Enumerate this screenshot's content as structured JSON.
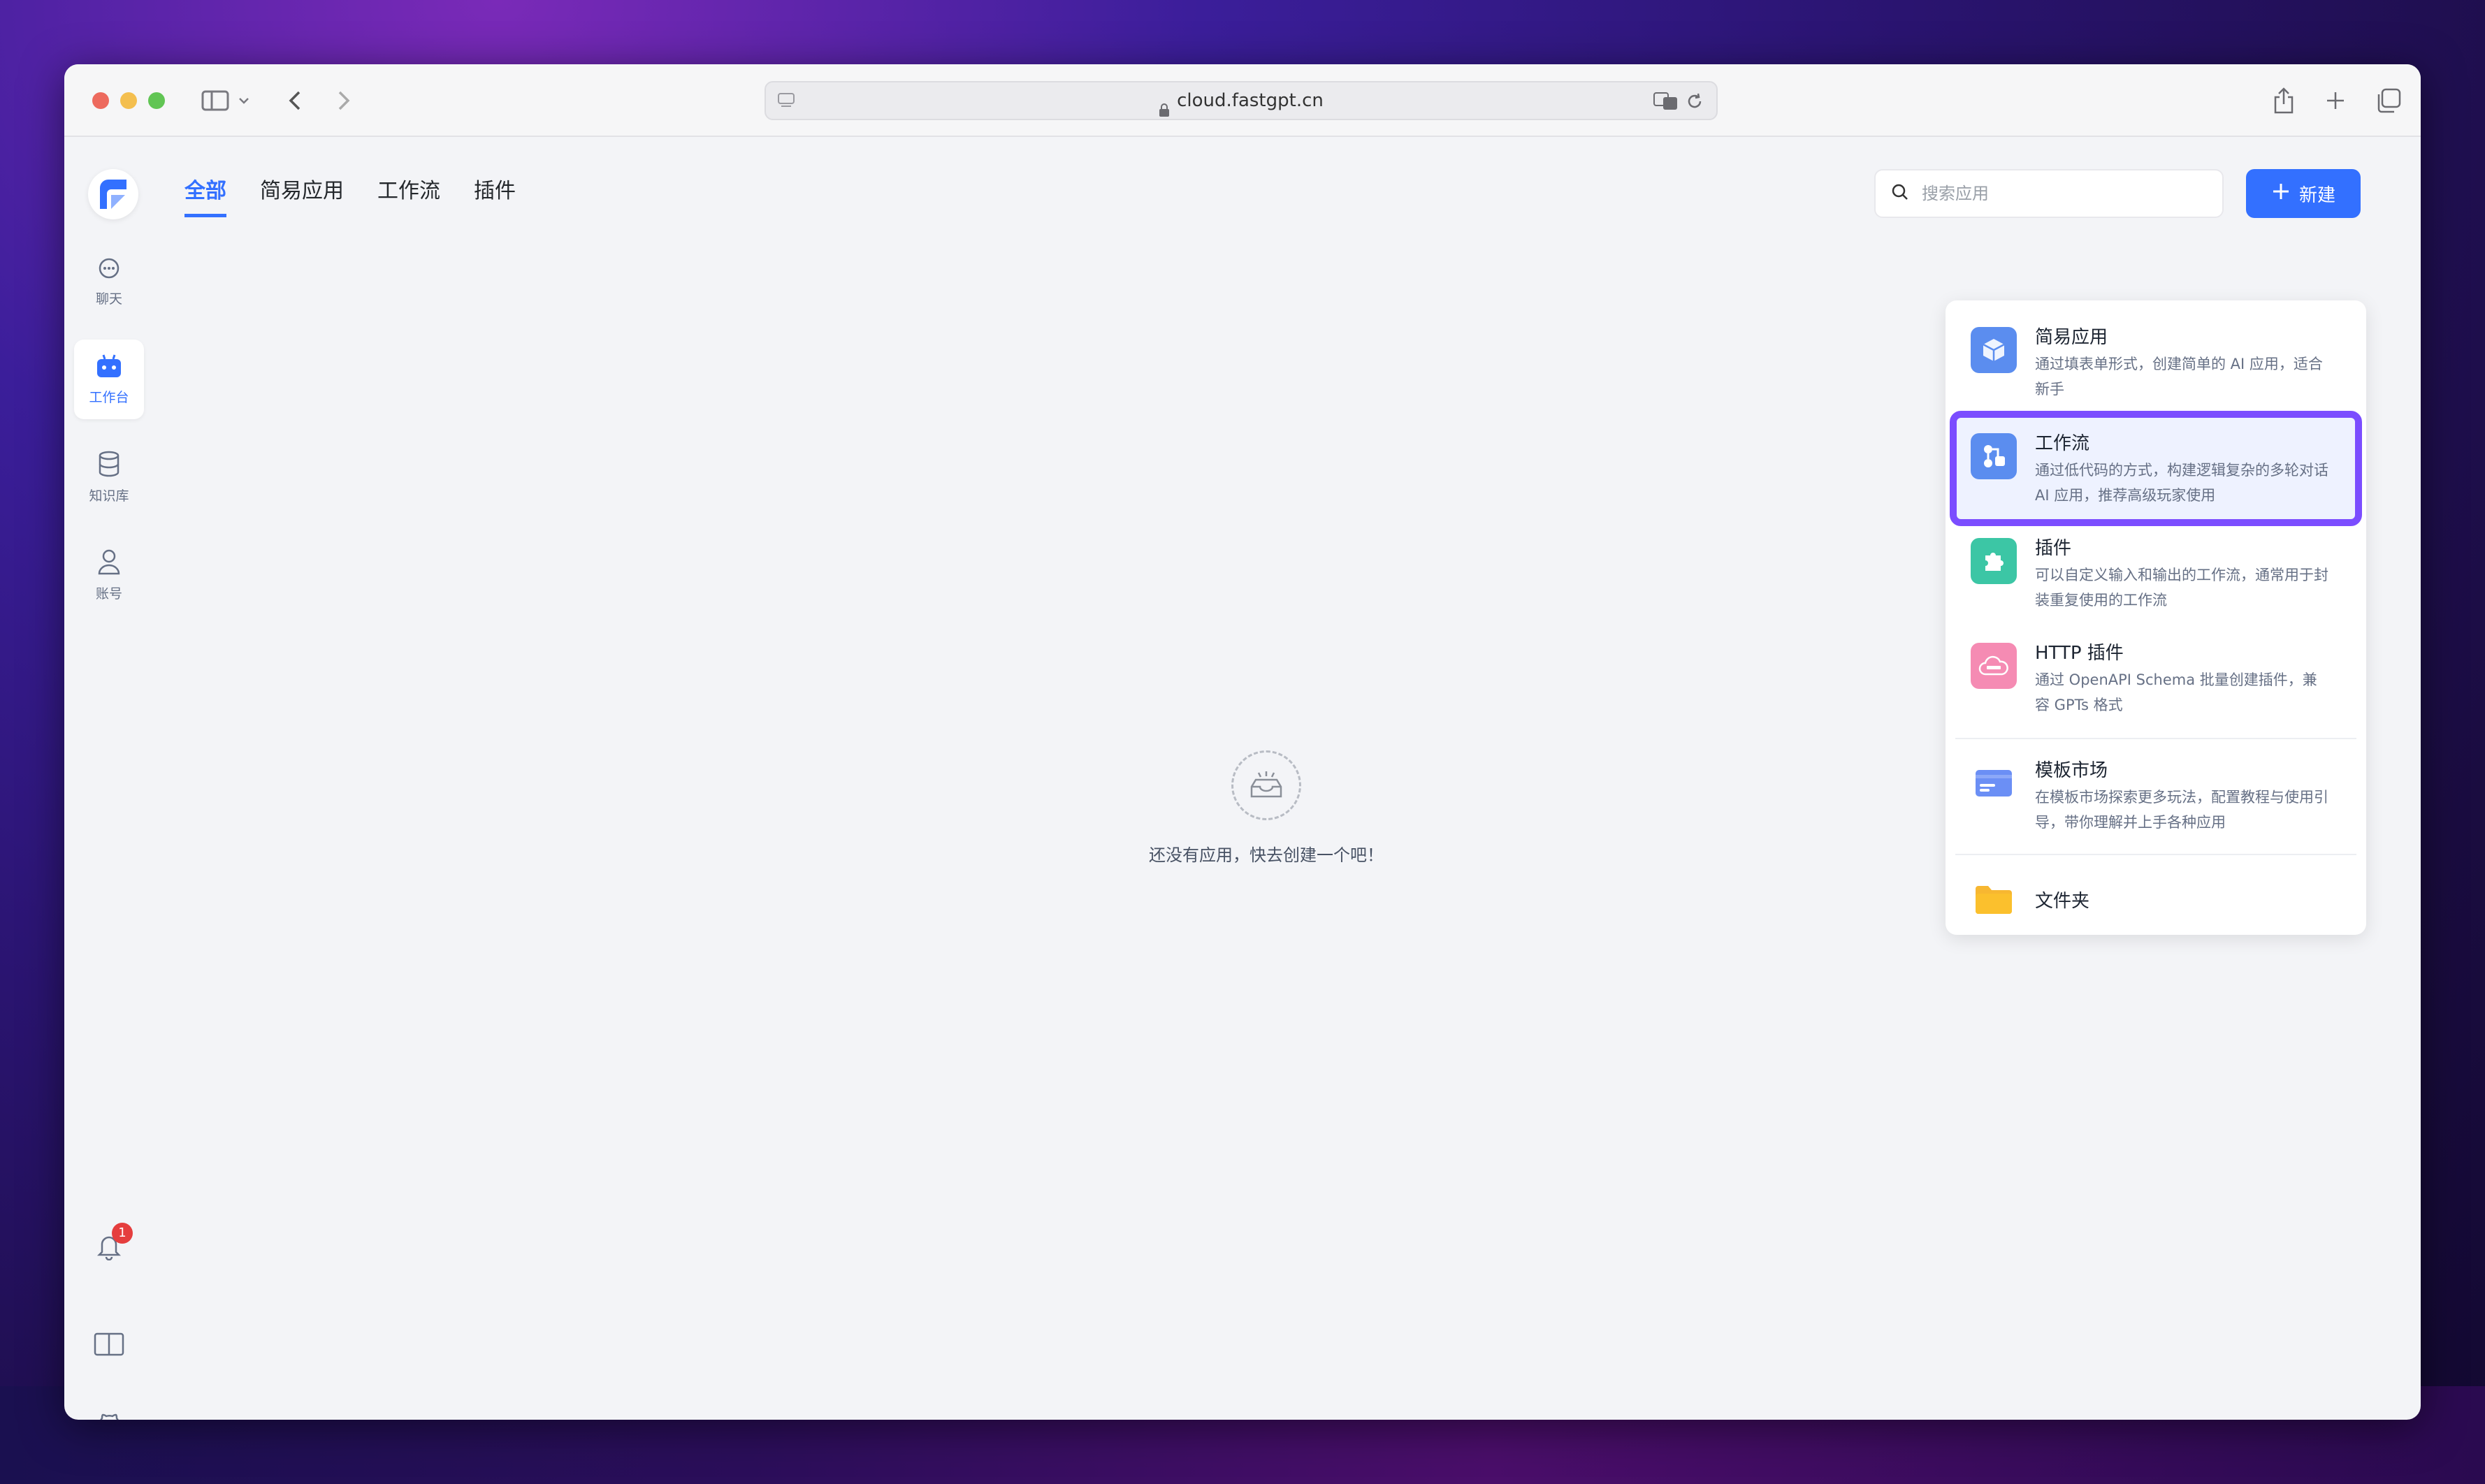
{
  "browser": {
    "url": "cloud.fastgpt.cn"
  },
  "tabs": [
    {
      "label": "全部",
      "active": true
    },
    {
      "label": "简易应用",
      "active": false
    },
    {
      "label": "工作流",
      "active": false
    },
    {
      "label": "插件",
      "active": false
    }
  ],
  "sidebar": {
    "items": [
      {
        "label": "聊天",
        "icon": "chat-icon"
      },
      {
        "label": "工作台",
        "icon": "robot-icon"
      },
      {
        "label": "知识库",
        "icon": "database-icon"
      },
      {
        "label": "账号",
        "icon": "user-icon"
      }
    ],
    "notification_count": "1"
  },
  "search": {
    "placeholder": "搜索应用"
  },
  "new_button": {
    "label": "新建"
  },
  "empty_state": {
    "text": "还没有应用，快去创建一个吧！"
  },
  "create_menu": {
    "items": [
      {
        "title": "简易应用",
        "desc": "通过填表单形式，创建简单的 AI 应用，适合新手",
        "icon": "cube-icon",
        "color": "#5b8def"
      },
      {
        "title": "工作流",
        "desc": "通过低代码的方式，构建逻辑复杂的多轮对话 AI 应用，推荐高级玩家使用",
        "icon": "workflow-icon",
        "color": "#5b8def"
      },
      {
        "title": "插件",
        "desc": "可以自定义输入和输出的工作流，通常用于封装重复使用的工作流",
        "icon": "puzzle-icon",
        "color": "#3cc6a5"
      },
      {
        "title": "HTTP 插件",
        "desc": "通过 OpenAPI Schema 批量创建插件，兼容 GPTs 格式",
        "icon": "http-cloud-icon",
        "color": "#f58bb3"
      },
      {
        "title": "模板市场",
        "desc": "在模板市场探索更多玩法，配置教程与使用引导，带你理解并上手各种应用",
        "icon": "template-card-icon",
        "color": "#6b8ff5"
      },
      {
        "title": "文件夹",
        "desc": "",
        "icon": "folder-icon",
        "color": "#f7b731"
      }
    ]
  },
  "colors": {
    "accent": "#3370ff",
    "highlight_outline": "#7b4dff"
  }
}
